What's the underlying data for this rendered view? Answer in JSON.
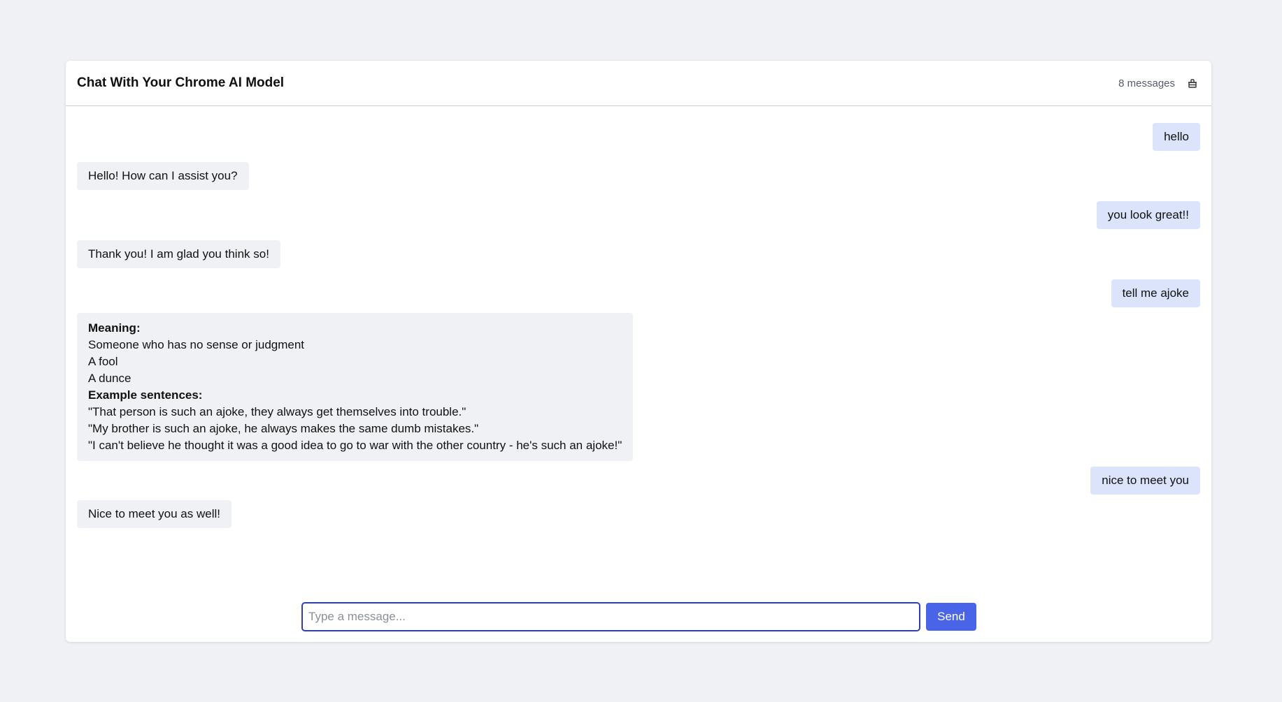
{
  "header": {
    "title": "Chat With Your Chrome AI Model",
    "message_count": "8 messages",
    "clear_icon": "clear-chat-icon"
  },
  "messages": [
    {
      "role": "user",
      "text": "hello"
    },
    {
      "role": "ai",
      "text": "Hello! How can I assist you?"
    },
    {
      "role": "user",
      "text": "you look great!!"
    },
    {
      "role": "ai",
      "text": "Thank you! I am glad you think so!"
    },
    {
      "role": "user",
      "text": "tell me ajoke"
    },
    {
      "role": "ai",
      "lines": [
        {
          "text": "Meaning:",
          "bold": true
        },
        {
          "text": "Someone who has no sense or judgment",
          "bold": false
        },
        {
          "text": "A fool",
          "bold": false
        },
        {
          "text": "A dunce",
          "bold": false
        },
        {
          "text": "Example sentences:",
          "bold": true
        },
        {
          "text": "\"That person is such an ajoke, they always get themselves into trouble.\"",
          "bold": false
        },
        {
          "text": "\"My brother is such an ajoke, he always makes the same dumb mistakes.\"",
          "bold": false
        },
        {
          "text": "\"I can't believe he thought it was a good idea to go to war with the other country - he's such an ajoke!\"",
          "bold": false
        }
      ]
    },
    {
      "role": "user",
      "text": "nice to meet you"
    },
    {
      "role": "ai",
      "text": "Nice to meet you as well!"
    }
  ],
  "composer": {
    "placeholder": "Type a message...",
    "value": "",
    "send_label": "Send"
  },
  "colors": {
    "user_bubble": "#dbe4fb",
    "ai_bubble": "#f0f1f4",
    "accent": "#4a64e8",
    "input_border": "#2f3fb0"
  }
}
